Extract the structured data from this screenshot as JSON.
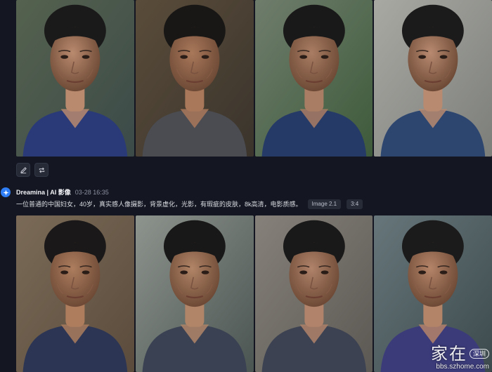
{
  "toolbar": {
    "edit_icon": "pencil-icon",
    "regenerate_icon": "repeat-icon"
  },
  "generation": {
    "avatar_icon": "dreamina-star-icon",
    "author": "Dreamina | AI 影像",
    "time": "03-28  16:35",
    "prompt": "一位普通的中国妇女，40岁，真实感人像摄影，背景虚化，光影，有瑕疵的皮肤，8k高清，电影质感。",
    "model_tag": "Image 2.1",
    "ratio_tag": "3:4"
  },
  "watermark": {
    "chars": "家在",
    "badge": "深圳",
    "url": "bbs.szhome.com"
  },
  "images": {
    "top": [
      {
        "bg": "#3b4a48",
        "bg2": "#55624f",
        "shirt": "#2a3a78",
        "skin": "#b98a6e",
        "hair": "#1b1a1a"
      },
      {
        "bg": "#3a342c",
        "bg2": "#5a4c3a",
        "shirt": "#4a4c52",
        "skin": "#a9785a",
        "hair": "#191716"
      },
      {
        "bg": "#3d5a3a",
        "bg2": "#6f7d6c",
        "shirt": "#253a66",
        "skin": "#a97d63",
        "hair": "#1a1919"
      },
      {
        "bg": "#7c7e7a",
        "bg2": "#a9a9a3",
        "shirt": "#2d4670",
        "skin": "#b88a70",
        "hair": "#1c1b1b"
      }
    ],
    "bottom": [
      {
        "bg": "#5a4b3c",
        "bg2": "#7a6a57",
        "shirt": "#2c3554",
        "skin": "#ad7d5e",
        "hair": "#1a1818"
      },
      {
        "bg": "#4a5451",
        "bg2": "#8e948e",
        "shirt": "#3a4152",
        "skin": "#b18567",
        "hair": "#191818"
      },
      {
        "bg": "#5b5853",
        "bg2": "#86817a",
        "shirt": "#3c4251",
        "skin": "#b0836a",
        "hair": "#1a1919"
      },
      {
        "bg": "#3c4a4d",
        "bg2": "#67767a",
        "shirt": "#3b3b7a",
        "skin": "#b48468",
        "hair": "#1c1b1b"
      }
    ]
  }
}
